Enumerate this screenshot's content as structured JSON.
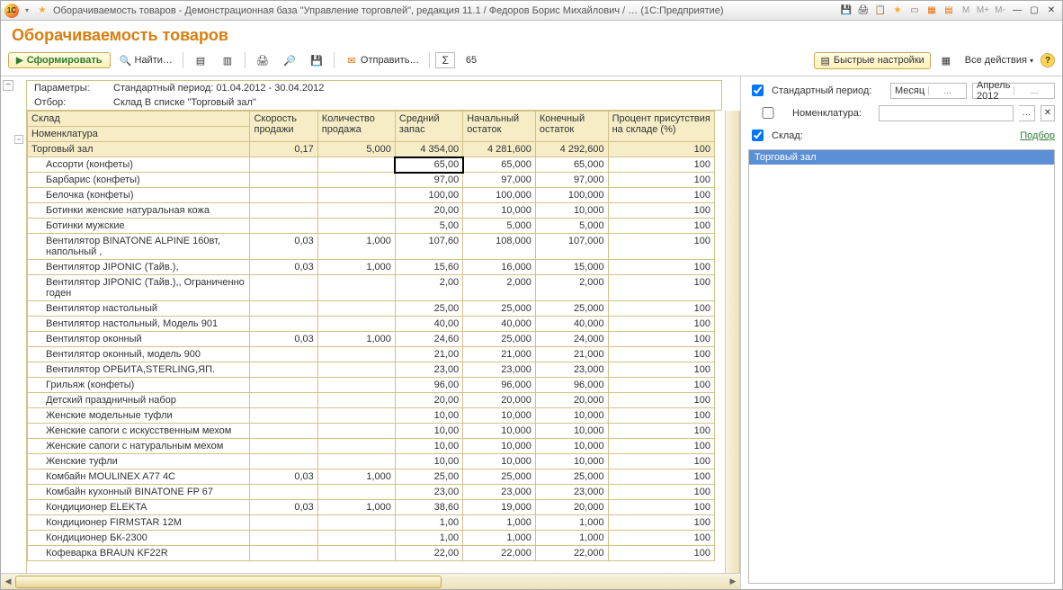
{
  "titlebar": {
    "logo_text": "1C",
    "title": "Оборачиваемость товаров - Демонстрационная база \"Управление торговлей\", редакция 11.1 / Федоров Борис Михайлович / … (1С:Предприятие)",
    "m_labels": [
      "M",
      "M+",
      "M-"
    ]
  },
  "page_title": "Оборачиваемость товаров",
  "toolbar": {
    "form": "Сформировать",
    "find": "Найти…",
    "send": "Отправить…",
    "sigma_value": "65",
    "quick_settings": "Быстрые настройки",
    "all_actions": "Все действия"
  },
  "params": {
    "label1": "Параметры:",
    "value1": "Стандартный период: 01.04.2012 - 30.04.2012",
    "label2": "Отбор:",
    "value2": "Склад В списке \"Торговый зал\""
  },
  "columns": {
    "c0a": "Склад",
    "c0b": "Номенклатура",
    "c1": "Скорость продажи",
    "c2": "Количество продажа",
    "c3": "Средний запас",
    "c4": "Начальный остаток",
    "c5": "Конечный остаток",
    "c6": "Процент присутствия на складе (%)"
  },
  "total_row": {
    "name": "Торговый зал",
    "c1": "0,17",
    "c2": "5,000",
    "c3": "4 354,00",
    "c4": "4 281,600",
    "c5": "4 292,600",
    "c6": "100"
  },
  "rows": [
    {
      "name": "Ассорти (конфеты)",
      "c1": "",
      "c2": "",
      "c3": "65,00",
      "c4": "65,000",
      "c5": "65,000",
      "c6": "100"
    },
    {
      "name": "Барбарис (конфеты)",
      "c1": "",
      "c2": "",
      "c3": "97,00",
      "c4": "97,000",
      "c5": "97,000",
      "c6": "100"
    },
    {
      "name": "Белочка (конфеты)",
      "c1": "",
      "c2": "",
      "c3": "100,00",
      "c4": "100,000",
      "c5": "100,000",
      "c6": "100"
    },
    {
      "name": "Ботинки женские натуральная кожа",
      "c1": "",
      "c2": "",
      "c3": "20,00",
      "c4": "10,000",
      "c5": "10,000",
      "c6": "100"
    },
    {
      "name": "Ботинки мужские",
      "c1": "",
      "c2": "",
      "c3": "5,00",
      "c4": "5,000",
      "c5": "5,000",
      "c6": "100"
    },
    {
      "name": "Вентилятор BINATONE ALPINE 160вт, напольный ,",
      "c1": "0,03",
      "c2": "1,000",
      "c3": "107,60",
      "c4": "108,000",
      "c5": "107,000",
      "c6": "100"
    },
    {
      "name": "Вентилятор JIPONIC (Тайв.),",
      "c1": "0,03",
      "c2": "1,000",
      "c3": "15,60",
      "c4": "16,000",
      "c5": "15,000",
      "c6": "100"
    },
    {
      "name": "Вентилятор JIPONIC (Тайв.),, Ограниченно годен",
      "c1": "",
      "c2": "",
      "c3": "2,00",
      "c4": "2,000",
      "c5": "2,000",
      "c6": "100"
    },
    {
      "name": "Вентилятор настольный",
      "c1": "",
      "c2": "",
      "c3": "25,00",
      "c4": "25,000",
      "c5": "25,000",
      "c6": "100"
    },
    {
      "name": "Вентилятор настольный, Модель 901",
      "c1": "",
      "c2": "",
      "c3": "40,00",
      "c4": "40,000",
      "c5": "40,000",
      "c6": "100"
    },
    {
      "name": "Вентилятор оконный",
      "c1": "0,03",
      "c2": "1,000",
      "c3": "24,60",
      "c4": "25,000",
      "c5": "24,000",
      "c6": "100"
    },
    {
      "name": "Вентилятор оконный, модель 900",
      "c1": "",
      "c2": "",
      "c3": "21,00",
      "c4": "21,000",
      "c5": "21,000",
      "c6": "100"
    },
    {
      "name": "Вентилятор ОРБИТА,STERLING,ЯП.",
      "c1": "",
      "c2": "",
      "c3": "23,00",
      "c4": "23,000",
      "c5": "23,000",
      "c6": "100"
    },
    {
      "name": "Грильяж (конфеты)",
      "c1": "",
      "c2": "",
      "c3": "96,00",
      "c4": "96,000",
      "c5": "96,000",
      "c6": "100"
    },
    {
      "name": "Детский праздничный набор",
      "c1": "",
      "c2": "",
      "c3": "20,00",
      "c4": "20,000",
      "c5": "20,000",
      "c6": "100"
    },
    {
      "name": "Женские модельные туфли",
      "c1": "",
      "c2": "",
      "c3": "10,00",
      "c4": "10,000",
      "c5": "10,000",
      "c6": "100"
    },
    {
      "name": "Женские сапоги с искусственным мехом",
      "c1": "",
      "c2": "",
      "c3": "10,00",
      "c4": "10,000",
      "c5": "10,000",
      "c6": "100"
    },
    {
      "name": "Женские сапоги с натуральным мехом",
      "c1": "",
      "c2": "",
      "c3": "10,00",
      "c4": "10,000",
      "c5": "10,000",
      "c6": "100"
    },
    {
      "name": "Женские туфли",
      "c1": "",
      "c2": "",
      "c3": "10,00",
      "c4": "10,000",
      "c5": "10,000",
      "c6": "100"
    },
    {
      "name": "Комбайн MOULINEX  A77 4C",
      "c1": "0,03",
      "c2": "1,000",
      "c3": "25,00",
      "c4": "25,000",
      "c5": "25,000",
      "c6": "100"
    },
    {
      "name": "Комбайн кухонный BINATONE FP 67",
      "c1": "",
      "c2": "",
      "c3": "23,00",
      "c4": "23,000",
      "c5": "23,000",
      "c6": "100"
    },
    {
      "name": "Кондиционер ELEKTA",
      "c1": "0,03",
      "c2": "1,000",
      "c3": "38,60",
      "c4": "19,000",
      "c5": "20,000",
      "c6": "100"
    },
    {
      "name": "Кондиционер FIRMSTAR 12M",
      "c1": "",
      "c2": "",
      "c3": "1,00",
      "c4": "1,000",
      "c5": "1,000",
      "c6": "100"
    },
    {
      "name": "Кондиционер БК-2300",
      "c1": "",
      "c2": "",
      "c3": "1,00",
      "c4": "1,000",
      "c5": "1,000",
      "c6": "100"
    },
    {
      "name": "Кофеварка BRAUN KF22R",
      "c1": "",
      "c2": "",
      "c3": "22,00",
      "c4": "22,000",
      "c5": "22,000",
      "c6": "100"
    }
  ],
  "settings": {
    "std_period_label": "Стандартный период:",
    "period_type": "Месяц",
    "period_value": "Апрель 2012",
    "nomenclature_label": "Номенклатура:",
    "warehouse_label": "Склад:",
    "pick": "Подбор",
    "list_item": "Торговый зал"
  }
}
